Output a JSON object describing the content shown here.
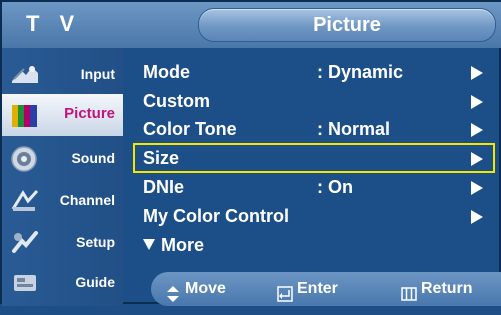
{
  "header": {
    "source_label": "T V",
    "title": "Picture"
  },
  "sidebar": {
    "items": [
      {
        "label": "Input",
        "icon": "input-icon"
      },
      {
        "label": "Picture",
        "icon": "picture-icon",
        "active": true
      },
      {
        "label": "Sound",
        "icon": "sound-icon"
      },
      {
        "label": "Channel",
        "icon": "channel-icon"
      },
      {
        "label": "Setup",
        "icon": "setup-icon"
      },
      {
        "label": "Guide",
        "icon": "guide-icon"
      }
    ]
  },
  "menu": {
    "rows": [
      {
        "name": "Mode",
        "value": ": Dynamic",
        "has_arrow": true
      },
      {
        "name": "Custom",
        "value": "",
        "has_arrow": true
      },
      {
        "name": "Color Tone",
        "value": ": Normal",
        "has_arrow": true
      },
      {
        "name": "Size",
        "value": "",
        "has_arrow": true,
        "selected": true
      },
      {
        "name": "DNIe",
        "value": ": On",
        "has_arrow": true
      },
      {
        "name": "My Color Control",
        "value": "",
        "has_arrow": true
      }
    ],
    "more_label": "More"
  },
  "help": {
    "move": "Move",
    "enter": "Enter",
    "return": "Return"
  },
  "colors": {
    "background": "#1c4f88",
    "highlight_border": "#f5e600",
    "active_label": "#c0137c",
    "text": "#ffffff"
  }
}
